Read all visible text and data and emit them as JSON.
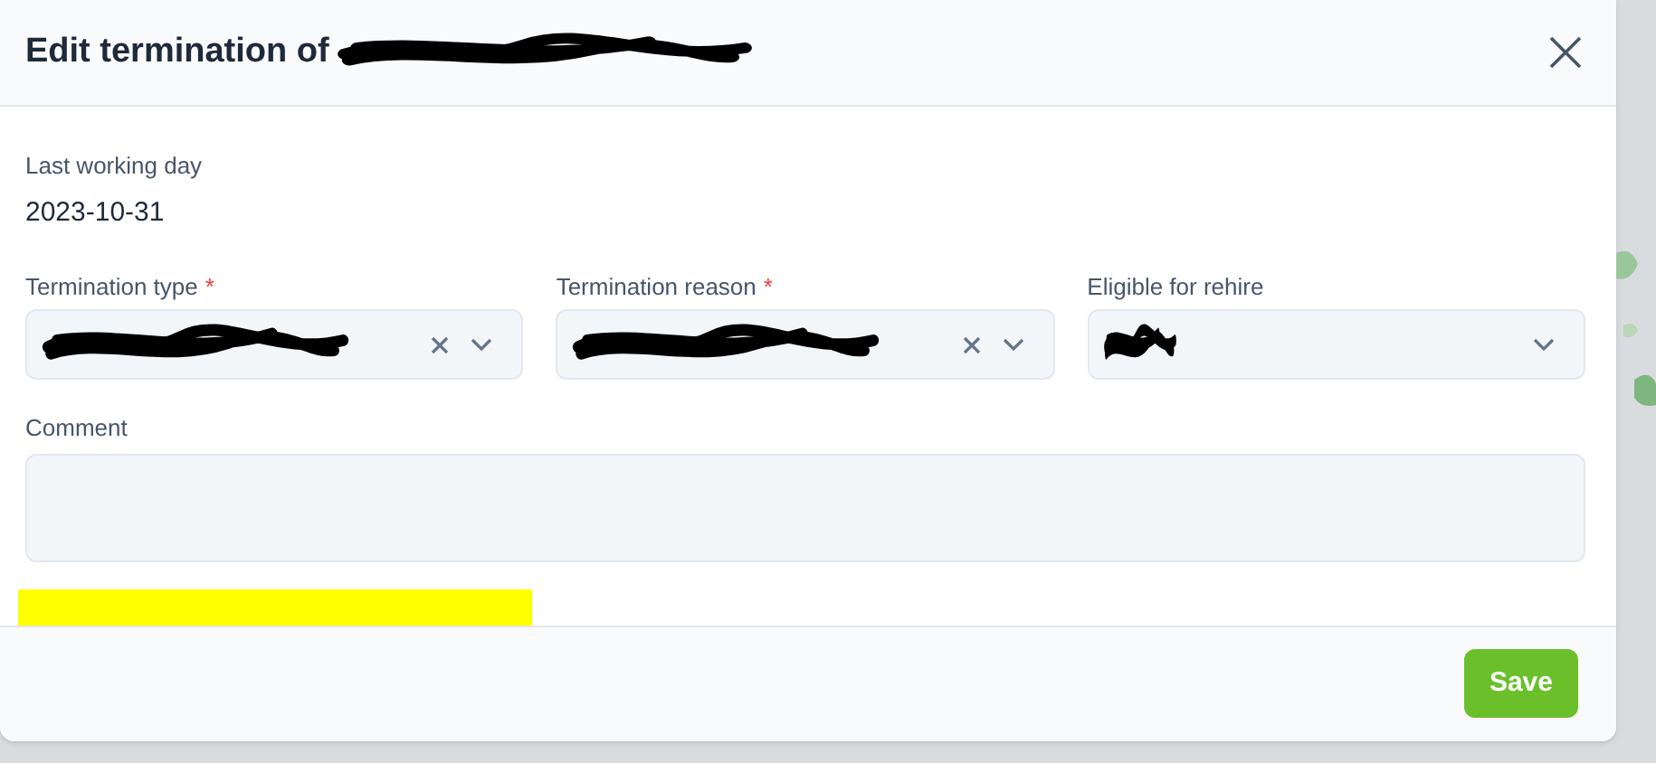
{
  "dialog": {
    "title": "Edit termination of",
    "title_redacted": true
  },
  "last_working_day": {
    "label": "Last working day",
    "value": "2023-10-31"
  },
  "fields": [
    {
      "label": "Termination type",
      "required_mark": "*",
      "redacted": true,
      "clearable": true
    },
    {
      "label": "Termination reason",
      "required_mark": "*",
      "redacted": true,
      "clearable": true
    },
    {
      "label": "Eligible for rehire",
      "redacted": true,
      "clearable": false
    }
  ],
  "comment": {
    "label": "Comment"
  },
  "highlight_mark": true,
  "buttons": [
    {
      "label": "Save"
    }
  ]
}
